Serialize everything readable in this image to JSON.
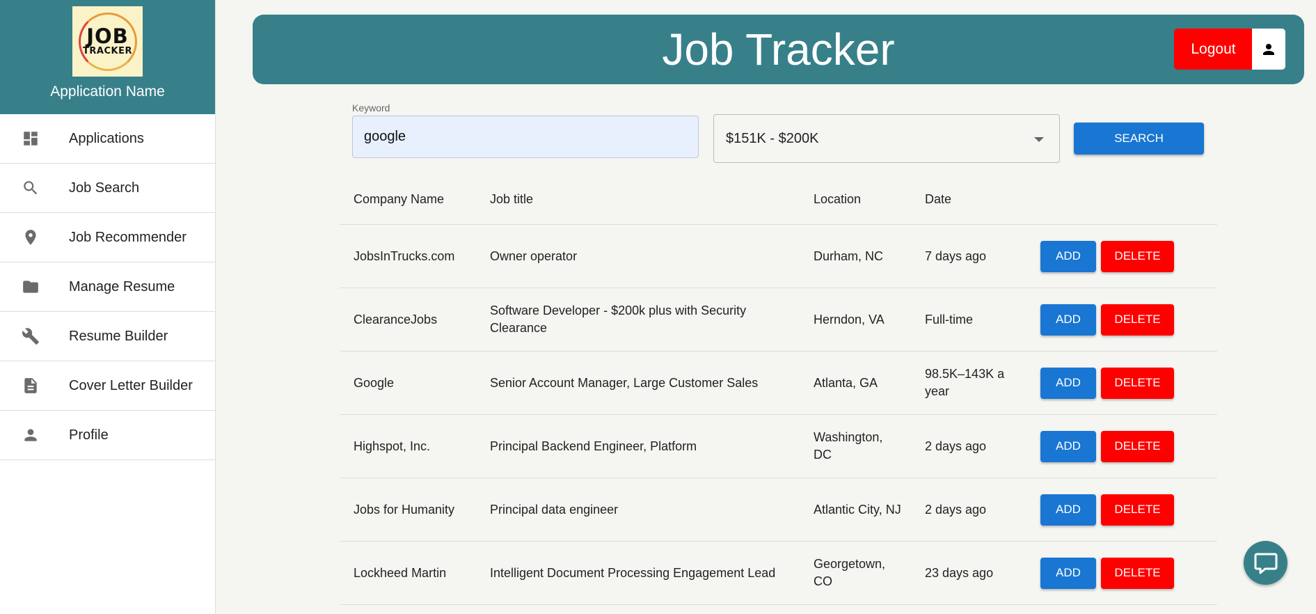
{
  "sidebar": {
    "logo_line1": "JOB",
    "logo_line2": "TRACKER",
    "app_name": "Application Name",
    "items": [
      {
        "label": "Applications",
        "icon": "dashboard-icon"
      },
      {
        "label": "Job Search",
        "icon": "search-icon"
      },
      {
        "label": "Job Recommender",
        "icon": "location-pin-icon"
      },
      {
        "label": "Manage Resume",
        "icon": "folder-icon"
      },
      {
        "label": "Resume Builder",
        "icon": "wrench-icon"
      },
      {
        "label": "Cover Letter Builder",
        "icon": "document-icon"
      },
      {
        "label": "Profile",
        "icon": "person-icon"
      }
    ]
  },
  "header": {
    "title": "Job Tracker",
    "logout_label": "Logout"
  },
  "search": {
    "keyword_label": "Keyword",
    "keyword_value": "google",
    "salary_selected": "$151K - $200K",
    "search_label": "SEARCH"
  },
  "table": {
    "headers": [
      "Company Name",
      "Job title",
      "Location",
      "Date"
    ],
    "add_label": "ADD",
    "delete_label": "DELETE",
    "rows": [
      {
        "company": "JobsInTrucks.com",
        "title": "Owner operator",
        "location": "Durham, NC",
        "date": "7 days ago"
      },
      {
        "company": "ClearanceJobs",
        "title": "Software Developer - $200k plus with Security Clearance",
        "location": "Herndon, VA",
        "date": "Full-time"
      },
      {
        "company": "Google",
        "title": "Senior Account Manager, Large Customer Sales",
        "location": "Atlanta, GA",
        "date": "98.5K–143K a year"
      },
      {
        "company": "Highspot, Inc.",
        "title": "Principal Backend Engineer, Platform",
        "location": "Washington, DC",
        "date": "2 days ago"
      },
      {
        "company": "Jobs for Humanity",
        "title": "Principal data engineer",
        "location": "Atlantic City, NJ",
        "date": "2 days ago"
      },
      {
        "company": "Lockheed Martin",
        "title": "Intelligent Document Processing Engagement Lead",
        "location": "Georgetown, CO",
        "date": "23 days ago"
      }
    ]
  },
  "colors": {
    "teal": "#37808a",
    "primary_blue": "#1976d2",
    "danger_red": "#ff0000"
  }
}
